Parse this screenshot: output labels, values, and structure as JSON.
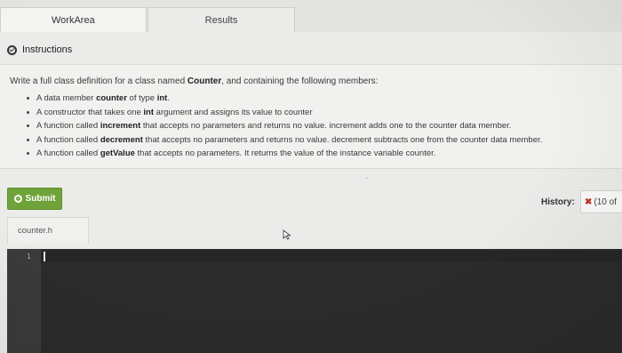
{
  "tabs": {
    "workarea": "WorkArea",
    "results": "Results"
  },
  "section": {
    "title": "Instructions"
  },
  "instructions": {
    "intro_pre": "Write a full class definition for a class named ",
    "intro_bold": "Counter",
    "intro_post": ", and containing the following members:",
    "bullets": [
      {
        "pre": "A data member ",
        "b1": "counter",
        "mid": " of type ",
        "b2": "int",
        "post": "."
      },
      {
        "pre": "A constructor that takes one ",
        "b1": "int",
        "post": " argument and assigns its value to counter"
      },
      {
        "pre": "A function called ",
        "b1": "increment",
        "post": " that accepts no parameters and returns no value. increment adds one to the counter data member."
      },
      {
        "pre": "A function called ",
        "b1": "decrement",
        "post": " that accepts no parameters and returns no value. decrement subtracts one from the counter data member."
      },
      {
        "pre": "A function called ",
        "b1": "getValue",
        "post": " that accepts no parameters. It returns the value of the instance variable counter."
      }
    ],
    "scroll_hint": "⌄"
  },
  "toolbar": {
    "submit_label": "Submit",
    "history_label": "History:",
    "history_mark": "✖",
    "history_value": "(10 of"
  },
  "editor": {
    "file_name": "counter.h",
    "line_numbers": [
      "1"
    ]
  },
  "colors": {
    "submit_green": "#6fa33a",
    "editor_bg": "#2b2b2b",
    "error_red": "#c0392b"
  }
}
